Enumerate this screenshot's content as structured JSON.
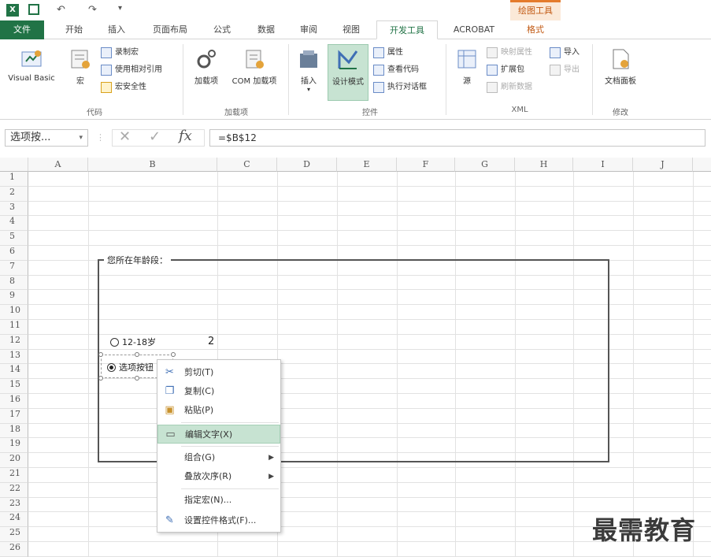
{
  "ribbon_context_tab": "绘图工具",
  "tabs": [
    "文件",
    "开始",
    "插入",
    "页面布局",
    "公式",
    "数据",
    "审阅",
    "视图",
    "开发工具",
    "ACROBAT",
    "格式"
  ],
  "ribbon": {
    "code": {
      "visual_basic": "Visual Basic",
      "macros": "宏",
      "record_macro": "录制宏",
      "relative_ref": "使用相对引用",
      "macro_security": "宏安全性",
      "label": "代码"
    },
    "addins": {
      "addins": "加载项",
      "com_addins": "COM 加载项",
      "label": "加载项"
    },
    "controls": {
      "insert": "插入",
      "design_mode": "设计模式",
      "properties": "属性",
      "view_code": "查看代码",
      "run_dialog": "执行对话框",
      "label": "控件"
    },
    "xml": {
      "source": "源",
      "map_props": "映射属性",
      "expansion": "扩展包",
      "refresh": "刷新数据",
      "import": "导入",
      "export": "导出",
      "label": "XML"
    },
    "modify": {
      "doc_panel": "文档面板",
      "label": "修改"
    }
  },
  "formula_bar": {
    "name_box": "选项按...",
    "formula": "=$B$12"
  },
  "columns": [
    "A",
    "B",
    "C",
    "D",
    "E",
    "F",
    "G",
    "H",
    "I",
    "J"
  ],
  "rows": [
    "1",
    "2",
    "3",
    "4",
    "5",
    "6",
    "7",
    "8",
    "9",
    "10",
    "11",
    "12",
    "13",
    "14",
    "15",
    "16",
    "17",
    "18",
    "19",
    "20",
    "21",
    "22",
    "23",
    "24",
    "25",
    "26"
  ],
  "groupbox": {
    "title": "您所在年龄段：",
    "option1": "12-18岁",
    "option2": "选项按钮",
    "cell_value": "2"
  },
  "context_menu": {
    "cut": "剪切(T)",
    "copy": "复制(C)",
    "paste": "粘贴(P)",
    "edit_text": "编辑文字(X)",
    "group": "组合(G)",
    "order": "叠放次序(R)",
    "assign_macro": "指定宏(N)...",
    "format_control": "设置控件格式(F)..."
  },
  "watermark": "最需教育",
  "colors": {
    "accent": "#217346",
    "highlight": "#c7e3d2",
    "context_tab": "#e47b2c"
  }
}
